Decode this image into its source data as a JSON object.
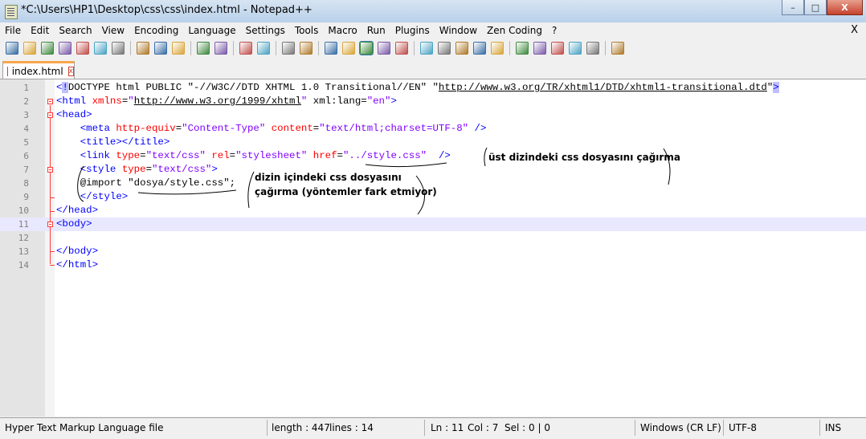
{
  "window": {
    "title": "*C:\\Users\\HP1\\Desktop\\css\\css\\index.html - Notepad++",
    "minimize": "–",
    "maximize": "□",
    "close": "X"
  },
  "menu": {
    "items": [
      "File",
      "Edit",
      "Search",
      "View",
      "Encoding",
      "Language",
      "Settings",
      "Tools",
      "Macro",
      "Run",
      "Plugins",
      "Window",
      "Zen Coding",
      "?"
    ],
    "close": "X"
  },
  "tabs": [
    {
      "label": "index.html",
      "close": "x"
    }
  ],
  "editor": {
    "lines": [
      {
        "n": "1",
        "tokens": [
          [
            "tag",
            "<"
          ],
          [
            "tag hl",
            "!"
          ],
          [
            "plain",
            "DOCTYPE html PUBLIC \"-//W3C//DTD XHTML 1.0 Transitional//EN\" \""
          ],
          [
            "url",
            "http://www.w3.org/TR/xhtml1/DTD/xhtml1-transitional.dtd"
          ],
          [
            "plain",
            "\""
          ],
          [
            "tag hl",
            ">"
          ]
        ]
      },
      {
        "n": "2",
        "tokens": [
          [
            "tag",
            "<html "
          ],
          [
            "attr",
            "xmlns"
          ],
          [
            "plain",
            "="
          ],
          [
            "str",
            "\""
          ],
          [
            "str url",
            "http://www.w3.org/1999/xhtml"
          ],
          [
            "str",
            "\""
          ],
          [
            "plain",
            " xml:lang="
          ],
          [
            "str",
            "\"en\""
          ],
          [
            "tag",
            ">"
          ]
        ]
      },
      {
        "n": "3",
        "tokens": [
          [
            "tag",
            "<head>"
          ]
        ]
      },
      {
        "n": "4",
        "tokens": [
          [
            "plain",
            "    "
          ],
          [
            "tag",
            "<meta "
          ],
          [
            "attr",
            "http-equiv"
          ],
          [
            "plain",
            "="
          ],
          [
            "str",
            "\"Content-Type\""
          ],
          [
            "plain",
            " "
          ],
          [
            "attr",
            "content"
          ],
          [
            "plain",
            "="
          ],
          [
            "str",
            "\"text/html;charset=UTF-8\""
          ],
          [
            "plain",
            " "
          ],
          [
            "tag",
            "/>"
          ]
        ]
      },
      {
        "n": "5",
        "tokens": [
          [
            "plain",
            "    "
          ],
          [
            "tag",
            "<title></title>"
          ]
        ]
      },
      {
        "n": "6",
        "tokens": [
          [
            "plain",
            "    "
          ],
          [
            "tag",
            "<link "
          ],
          [
            "attr",
            "type"
          ],
          [
            "plain",
            "="
          ],
          [
            "str",
            "\"text/css\""
          ],
          [
            "plain",
            " "
          ],
          [
            "attr",
            "rel"
          ],
          [
            "plain",
            "="
          ],
          [
            "str",
            "\"stylesheet\""
          ],
          [
            "plain",
            " "
          ],
          [
            "attr",
            "href"
          ],
          [
            "plain",
            "="
          ],
          [
            "str",
            "\"../style.css\""
          ],
          [
            "plain",
            "  "
          ],
          [
            "tag",
            "/>"
          ]
        ]
      },
      {
        "n": "7",
        "tokens": [
          [
            "plain",
            "    "
          ],
          [
            "tag",
            "<style "
          ],
          [
            "attr",
            "type"
          ],
          [
            "plain",
            "="
          ],
          [
            "str",
            "\"text/css\""
          ],
          [
            "tag",
            ">"
          ]
        ]
      },
      {
        "n": "8",
        "tokens": [
          [
            "plain",
            "    @import \"dosya/style.css\";"
          ]
        ]
      },
      {
        "n": "9",
        "tokens": [
          [
            "plain",
            "    "
          ],
          [
            "tag",
            "</style>"
          ]
        ]
      },
      {
        "n": "10",
        "tokens": [
          [
            "tag",
            "</head>"
          ]
        ]
      },
      {
        "n": "11",
        "tokens": [
          [
            "tag",
            "<body>"
          ]
        ]
      },
      {
        "n": "12",
        "tokens": []
      },
      {
        "n": "13",
        "tokens": [
          [
            "tag",
            "</body>"
          ]
        ]
      },
      {
        "n": "14",
        "tokens": [
          [
            "tag",
            "</html>"
          ]
        ]
      }
    ],
    "active_line": 11
  },
  "annotations": {
    "note1": "üst dizindeki css dosyasını çağırma",
    "note2_line1": "dizin içindeki css dosyasını",
    "note2_line2": "çağırma (yöntemler fark etmiyor)"
  },
  "status": {
    "file_type": "Hyper Text Markup Language file",
    "length": "length : 447",
    "lines": "lines : 14",
    "ln": "Ln : 11",
    "col": "Col : 7",
    "sel": "Sel : 0 | 0",
    "eol": "Windows (CR LF)",
    "encoding": "UTF-8",
    "mode": "INS"
  },
  "toolbar_icons": [
    "new-file-icon",
    "open-file-icon",
    "save-icon",
    "save-all-icon",
    "close-icon",
    "close-all-icon",
    "print-icon",
    "sep",
    "cut-icon",
    "copy-icon",
    "paste-icon",
    "sep",
    "undo-icon",
    "redo-icon",
    "sep",
    "find-icon",
    "replace-icon",
    "sep",
    "zoom-in-icon",
    "zoom-out-icon",
    "sep",
    "sync-vertical-icon",
    "sync-horizontal-icon",
    "word-wrap-icon",
    "show-all-chars-icon",
    "indent-guide-icon",
    "sep",
    "user-language-icon",
    "doc-map-icon",
    "function-list-icon",
    "folder-workspace-icon",
    "monitoring-icon",
    "sep",
    "record-macro-icon",
    "stop-record-icon",
    "play-macro-icon",
    "run-multiple-icon",
    "save-macro-icon",
    "sep",
    "spell-check-icon"
  ]
}
